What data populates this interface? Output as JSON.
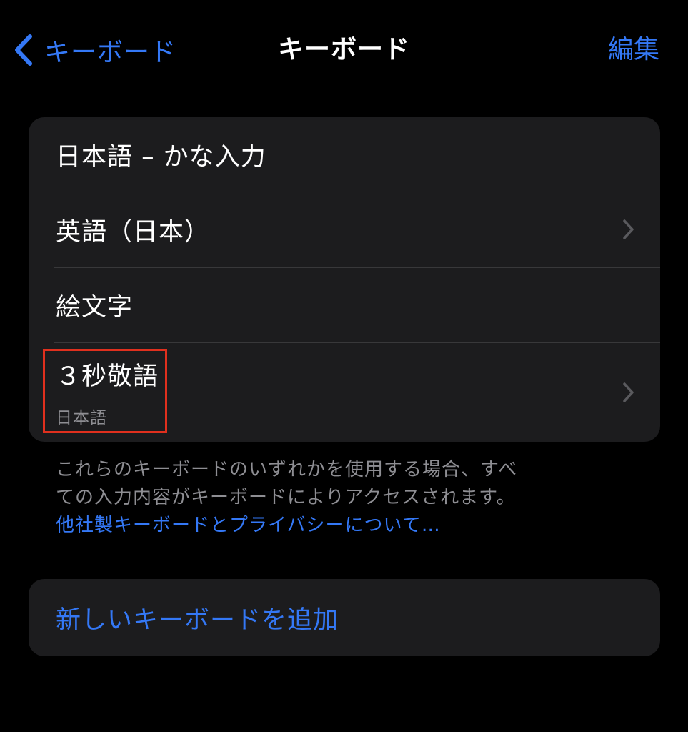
{
  "nav": {
    "back_label": "キーボード",
    "title": "キーボード",
    "edit_label": "編集"
  },
  "keyboards": [
    {
      "label": "日本語 – かな入力",
      "has_chevron": false
    },
    {
      "label": "英語（日本）",
      "has_chevron": true
    },
    {
      "label": "絵文字",
      "has_chevron": false
    },
    {
      "label": "３秒敬語",
      "sublabel": "日本語",
      "has_chevron": true,
      "highlighted": true
    }
  ],
  "footer": {
    "line1": "これらのキーボードのいずれかを使用する場合、すべ",
    "line2": "ての入力内容がキーボードによりアクセスされます。",
    "link": "他社製キーボードとプライバシーについて…"
  },
  "add_keyboard": {
    "label": "新しいキーボードを追加"
  },
  "colors": {
    "background": "#000000",
    "group_background": "#1c1c1e",
    "accent": "#3478f6",
    "secondary_text": "#8e8e93",
    "separator": "#38383a",
    "highlight_border": "#e0301e"
  },
  "icons": {
    "back": "chevron-left-icon",
    "disclosure": "chevron-right-icon"
  }
}
